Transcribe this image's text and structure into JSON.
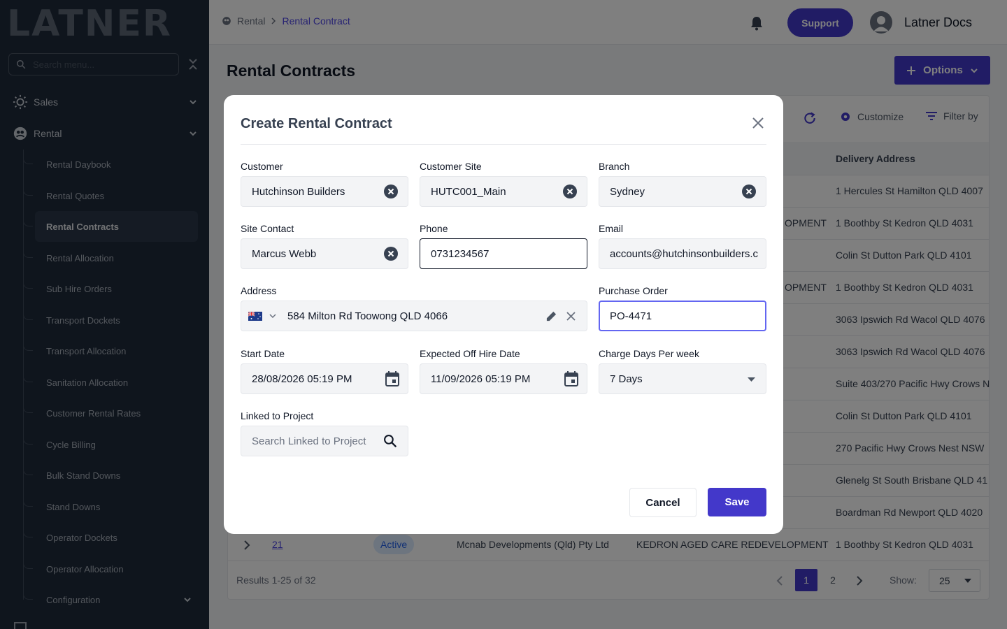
{
  "sidebar": {
    "logo": "LATNER",
    "search_placeholder": "Search menu...",
    "sections": [
      {
        "label": "Sales"
      },
      {
        "label": "Rental"
      }
    ],
    "items": [
      {
        "label": "Rental Daybook"
      },
      {
        "label": "Rental Quotes"
      },
      {
        "label": "Rental Contracts"
      },
      {
        "label": "Rental Allocation"
      },
      {
        "label": "Sub Hire Orders"
      },
      {
        "label": "Transport Dockets"
      },
      {
        "label": "Transport Allocation"
      },
      {
        "label": "Sanitation Allocation"
      },
      {
        "label": "Customer Rental Rates"
      },
      {
        "label": "Cycle Billing"
      },
      {
        "label": "Bulk Stand Downs"
      },
      {
        "label": "Stand Downs"
      },
      {
        "label": "Operator Dockets"
      },
      {
        "label": "Operator Allocation"
      },
      {
        "label": "Configuration"
      }
    ],
    "active_item": "Rental Contracts"
  },
  "header": {
    "breadcrumb": [
      "Rental",
      "Rental Contract"
    ],
    "support_label": "Support",
    "user_name": "Latner Docs"
  },
  "page": {
    "title": "Rental Contracts",
    "options_label": "Options",
    "customize_label": "Customize",
    "filter_label": "Filter by"
  },
  "table": {
    "column": "Delivery Address",
    "rows": [
      {
        "mid": "",
        "address": "1 Hercules St Hamilton QLD 4007"
      },
      {
        "mid": "OPMENT",
        "address": "1 Boothby St Kedron QLD 4031"
      },
      {
        "mid": "",
        "address": "Colin St Dutton Park QLD 4101"
      },
      {
        "mid": "OPMENT",
        "address": "1 Boothby St Kedron QLD 4031"
      },
      {
        "mid": "",
        "address": "3063 Ipswich Rd Wacol QLD 4076"
      },
      {
        "mid": "",
        "address": "3063 Ipswich Rd Wacol QLD 4076"
      },
      {
        "mid": "",
        "address": "Suite 403/270 Pacific Hwy Crows N"
      },
      {
        "mid": "",
        "address": "Colin St Dutton Park QLD 4101"
      },
      {
        "mid": "",
        "address": "270 Pacific Hwy Crows Nest NSW"
      },
      {
        "mid": "",
        "address": "Glenelg St South Brisbane QLD 41"
      },
      {
        "mid": "",
        "address": "Boardman Rd Newport QLD 4020"
      }
    ],
    "last_row": {
      "number": "21",
      "status": "Active",
      "customer": "Mcnab Developments (Qld) Pty Ltd",
      "site": "KEDRON AGED CARE REDEVELOPMENT",
      "address": "1 Boothby St Kedron QLD 4031"
    },
    "results": "Results 1-25 of 32",
    "pages": [
      "1",
      "2"
    ],
    "show_label": "Show:",
    "show_value": "25"
  },
  "modal": {
    "title": "Create Rental Contract",
    "fields": {
      "customer": {
        "label": "Customer",
        "value": "Hutchinson Builders"
      },
      "customer_site": {
        "label": "Customer Site",
        "value": "HUTC001_Main"
      },
      "branch": {
        "label": "Branch",
        "value": "Sydney"
      },
      "site_contact": {
        "label": "Site Contact",
        "value": "Marcus Webb"
      },
      "phone": {
        "label": "Phone",
        "value": "0731234567"
      },
      "email": {
        "label": "Email",
        "value": "accounts@hutchinsonbuilders.c"
      },
      "address": {
        "label": "Address",
        "value": "584 Milton Rd Toowong QLD 4066"
      },
      "purchase_order": {
        "label": "Purchase Order",
        "value": "PO-4471"
      },
      "start_date": {
        "label": "Start Date",
        "value": "28/08/2026 05:19 PM"
      },
      "off_hire_date": {
        "label": "Expected Off Hire Date",
        "value": "11/09/2026 05:19 PM"
      },
      "charge_days": {
        "label": "Charge Days Per week",
        "value": "7 Days"
      },
      "linked_project": {
        "label": "Linked to Project",
        "placeholder": "Search Linked to Project"
      }
    },
    "cancel_label": "Cancel",
    "save_label": "Save"
  },
  "colors": {
    "primary": "#4338ca",
    "sidebar": "#1e2a3b",
    "focus": "#6366f1",
    "logo_accent": "#10b981"
  },
  "icons": [
    "search-icon",
    "collapse-icon",
    "sales-icon",
    "rental-icon",
    "chevron-down-icon",
    "bell-icon",
    "avatar-icon",
    "plus-icon",
    "refresh-icon",
    "gear-icon",
    "filter-icon",
    "close-icon",
    "clear-icon",
    "flag-au-icon",
    "edit-icon",
    "calendar-icon",
    "dropdown-arrow-icon"
  ]
}
